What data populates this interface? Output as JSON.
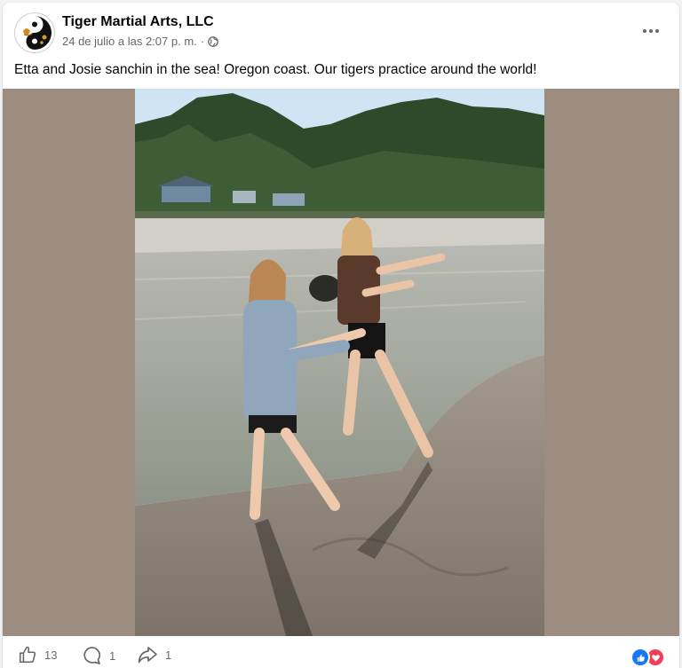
{
  "post": {
    "page_name": "Tiger Martial Arts, LLC",
    "timestamp": "24 de julio a las 2:07 p. m.",
    "separator": "·",
    "audience_icon": "globe-icon",
    "more_icon": "more-options-icon",
    "caption": "Etta and Josie sanchin in the sea!  Oregon coast.  Our tigers practice around the world!"
  },
  "footer": {
    "like_count": "13",
    "comment_count": "1",
    "share_count": "1",
    "reactions": [
      "like",
      "love"
    ]
  },
  "colors": {
    "like_blue": "#1877f2",
    "love_red": "#f33e58",
    "meta_gray": "#65676b",
    "photo_frame": "#9c8d80"
  }
}
